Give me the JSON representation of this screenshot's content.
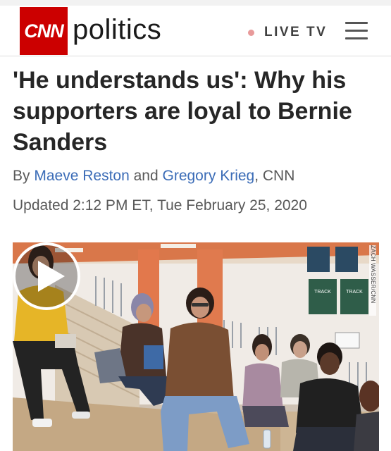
{
  "header": {
    "logo_text": "CNN",
    "section_name": "politics",
    "live_label": "LIVE TV"
  },
  "article": {
    "headline": "'He understands us': Why his supporters are loyal to Bernie Sanders",
    "byline_prefix": "By",
    "author_1": "Maeve Reston",
    "byline_and": "and",
    "author_2": "Gregory Krieg",
    "byline_suffix": ", CNN",
    "updated": "Updated 2:12 PM ET, Tue February 25, 2020"
  },
  "video": {
    "credit": "ZACH WASSER/CNN",
    "banners": [
      "TRACK",
      "TRACK",
      "TRACK"
    ]
  },
  "colors": {
    "brand_red": "#cc0000",
    "author_link": "#3b6cb7",
    "live_dot": "#e89a9a"
  },
  "icons": [
    "live-dot-icon",
    "hamburger-menu-icon",
    "play-icon"
  ]
}
